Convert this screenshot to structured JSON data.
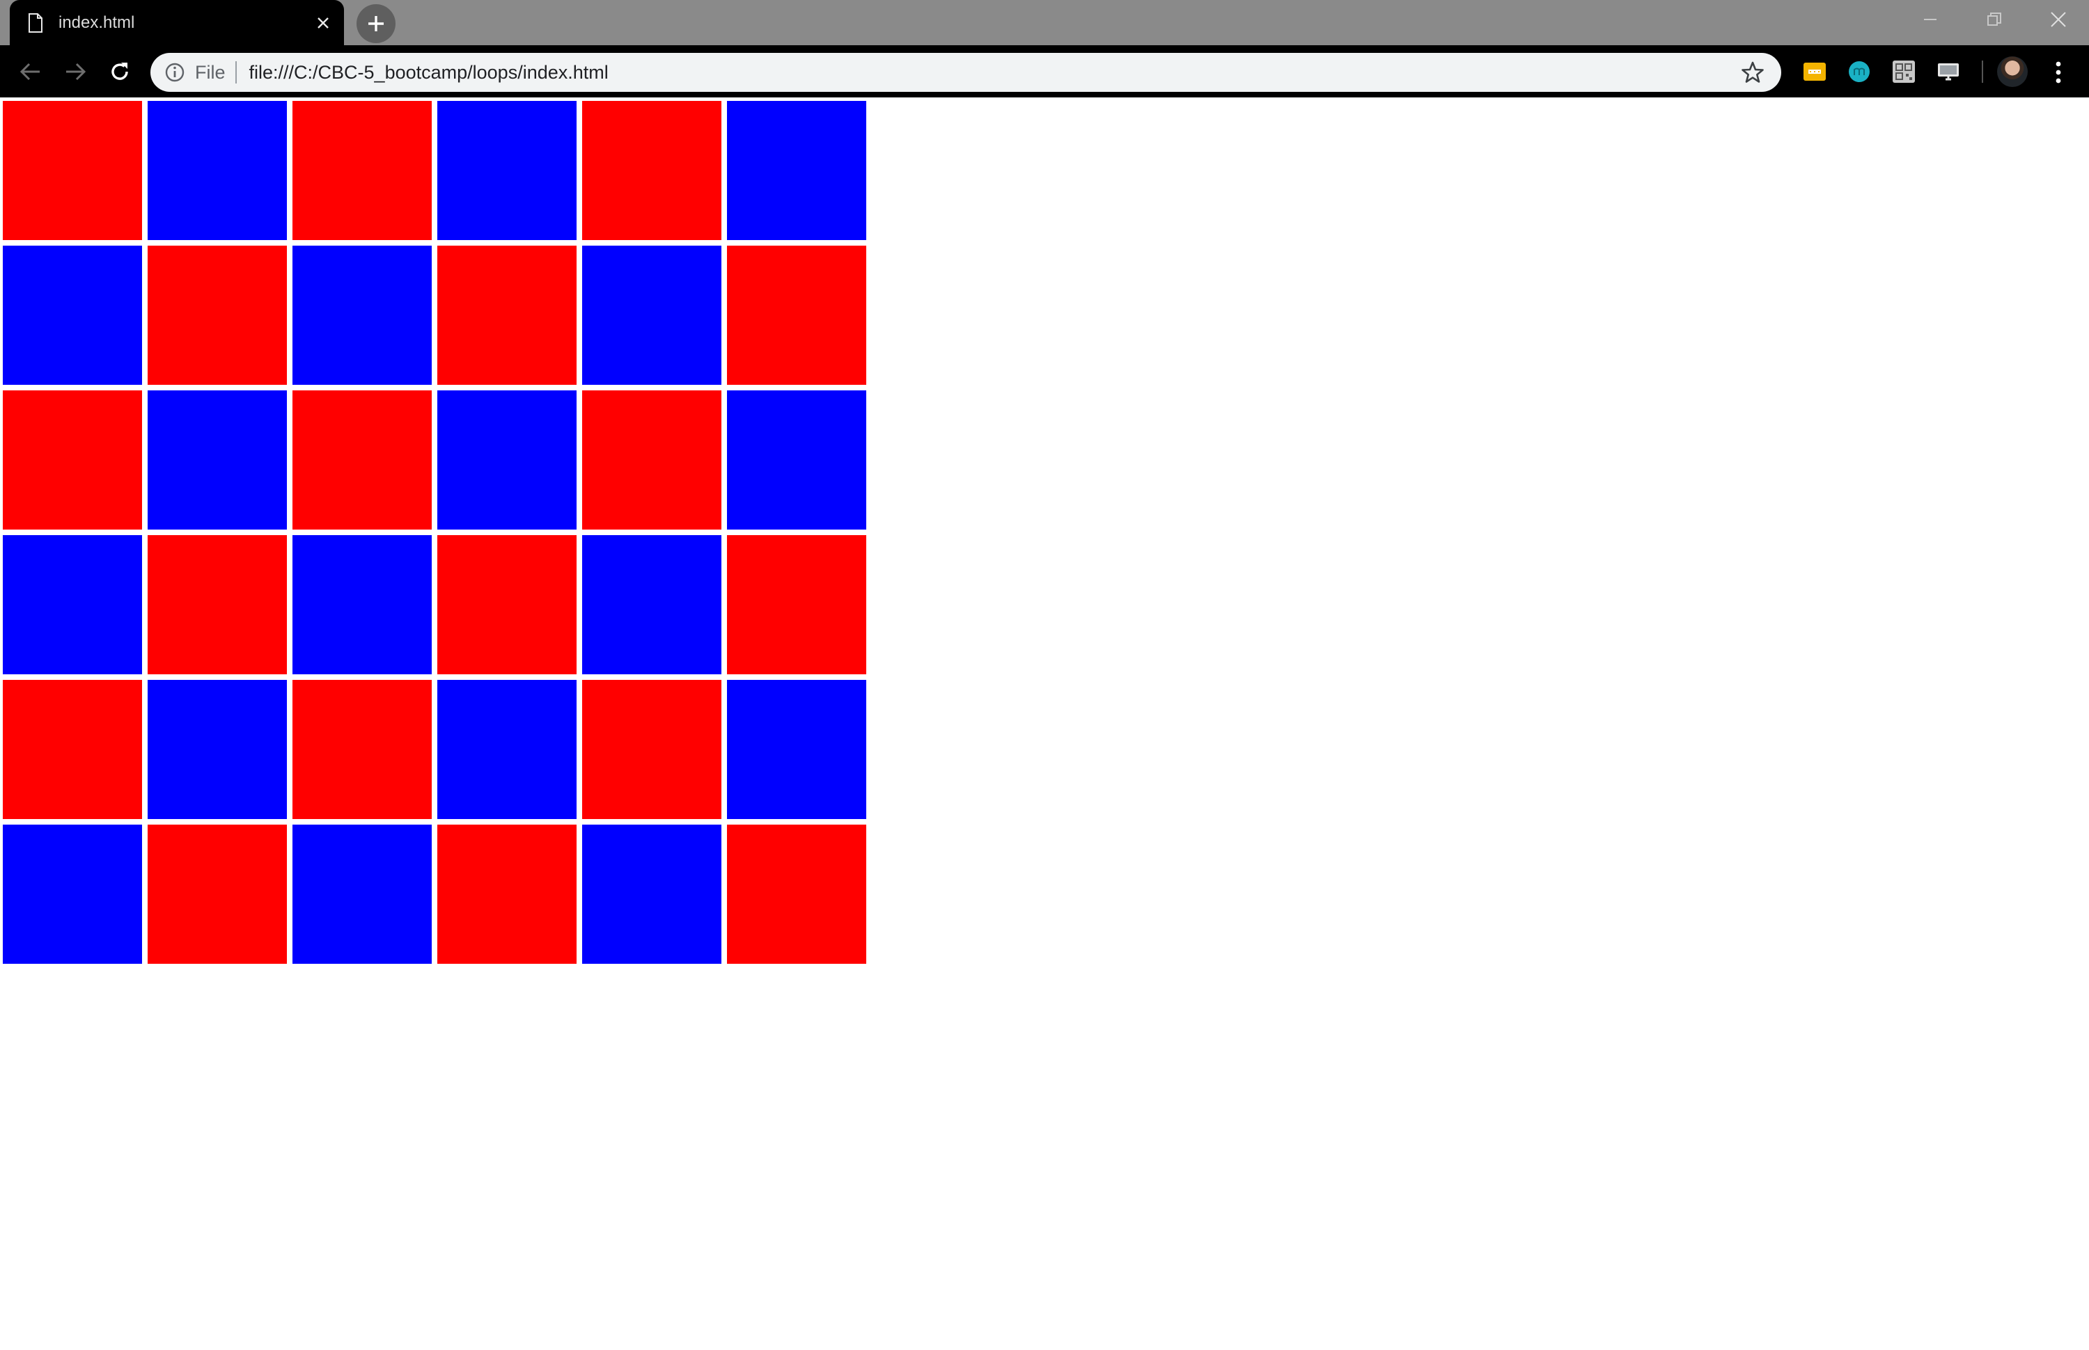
{
  "browser": {
    "tab": {
      "title": "index.html",
      "icon": "file-icon"
    },
    "address_bar": {
      "scheme_chip": "File",
      "url": "file:///C:/CBC-5_bootcamp/loops/index.html"
    }
  },
  "page": {
    "colors": {
      "red": "#ff0000",
      "blue": "#0000ff"
    },
    "grid": {
      "columns": 6,
      "rows": [
        [
          "red",
          "blue",
          "red",
          "blue",
          "red",
          "blue"
        ],
        [
          "blue",
          "red",
          "blue",
          "red",
          "blue",
          "red"
        ],
        [
          "red",
          "blue",
          "red",
          "blue",
          "red",
          "blue"
        ],
        [
          "blue",
          "red",
          "blue",
          "red",
          "blue",
          "red"
        ],
        [
          "red",
          "blue",
          "red",
          "blue",
          "red",
          "blue"
        ],
        [
          "blue",
          "red",
          "blue",
          "red",
          "blue",
          "red"
        ]
      ]
    }
  }
}
